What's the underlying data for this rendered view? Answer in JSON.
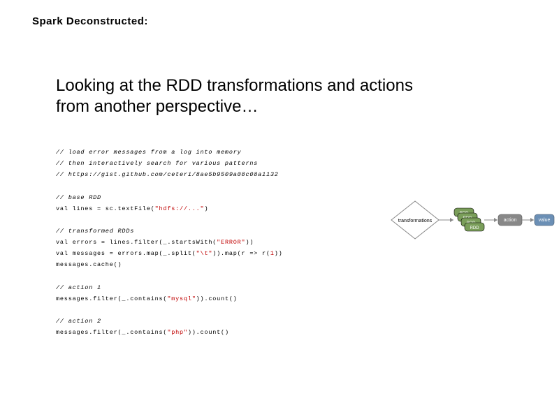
{
  "title": "Spark Deconstructed:",
  "subtitle": "Looking at the RDD transformations and actions from another perspective…",
  "code": {
    "c1": "// load error messages from a log into memory",
    "c2": "// then interactively search for various patterns",
    "c3": "// https://gist.github.com/ceteri/8ae5b9509a08c08a1132",
    "c4": "// base RDD",
    "l1a": "val lines = sc.textFile(",
    "l1b": "\"hdfs://...\"",
    "l1c": ")",
    "c5": "// transformed RDDs",
    "l2a": "val errors = lines.filter(_.startsWith(",
    "l2b": "\"ERROR\"",
    "l2c": "))",
    "l3a": "val messages = errors.map(_.split(",
    "l3b": "\"\\t\"",
    "l3c": ")).map(r => r(",
    "l3d": "1",
    "l3e": "))",
    "l4": "messages.cache()",
    "c6": "// action 1",
    "l5a": "messages.filter(_.contains(",
    "l5b": "\"mysql\"",
    "l5c": ")).count()",
    "c7": "// action 2",
    "l6a": "messages.filter(_.contains(",
    "l6b": "\"php\"",
    "l6c": ")).count()"
  },
  "diagram": {
    "transformations": "transformations",
    "rdd": "RDD",
    "action": "action",
    "value": "value"
  }
}
